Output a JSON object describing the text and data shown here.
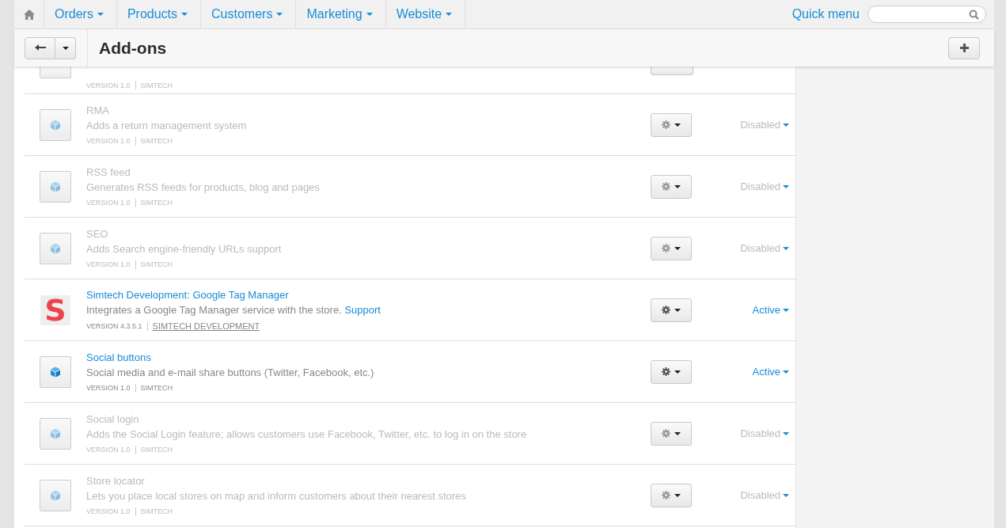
{
  "nav": {
    "items": [
      {
        "label": "Orders"
      },
      {
        "label": "Products"
      },
      {
        "label": "Customers"
      },
      {
        "label": "Marketing"
      },
      {
        "label": "Website"
      }
    ],
    "quick_menu": "Quick menu"
  },
  "toolbar": {
    "title": "Add-ons"
  },
  "addons": [
    {
      "kind": "clipped",
      "version": "VERSION 1.0",
      "vendor": "SIMTECH"
    },
    {
      "kind": "cube",
      "active": false,
      "title": "RMA",
      "description": "Adds a return management system",
      "version": "VERSION 1.0",
      "vendor": "SIMTECH",
      "status": "Disabled"
    },
    {
      "kind": "cube",
      "active": false,
      "title": "RSS feed",
      "description": "Generates RSS feeds for products, blog and pages",
      "version": "VERSION 1.0",
      "vendor": "SIMTECH",
      "status": "Disabled"
    },
    {
      "kind": "cube",
      "active": false,
      "title": "SEO",
      "description": "Adds Search engine-friendly URLs support",
      "version": "VERSION 1.0",
      "vendor": "SIMTECH",
      "status": "Disabled"
    },
    {
      "kind": "logo",
      "logo_letter": "S",
      "active": true,
      "title": "Simtech Development: Google Tag Manager",
      "description": "Integrates a Google Tag Manager service with the store.",
      "support": "Support",
      "version": "VERSION 4.3.5.1",
      "vendor": "SIMTECH DEVELOPMENT",
      "vendor_link": true,
      "status": "Active"
    },
    {
      "kind": "cube",
      "active": true,
      "title": "Social buttons",
      "description": "Social media and e-mail share buttons (Twitter, Facebook, etc.)",
      "version": "VERSION 1.0",
      "vendor": "SIMTECH",
      "status": "Active"
    },
    {
      "kind": "cube",
      "active": false,
      "title": "Social login",
      "description": "Adds the Social Login feature; allows customers use Facebook, Twitter, etc. to log in on the store",
      "version": "VERSION 1.0",
      "vendor": "SIMTECH",
      "status": "Disabled"
    },
    {
      "kind": "cube",
      "active": false,
      "title": "Store locator",
      "description": "Lets you place local stores on map and inform customers about their nearest stores",
      "version": "VERSION 1.0",
      "vendor": "SIMTECH",
      "status": "Disabled"
    }
  ]
}
